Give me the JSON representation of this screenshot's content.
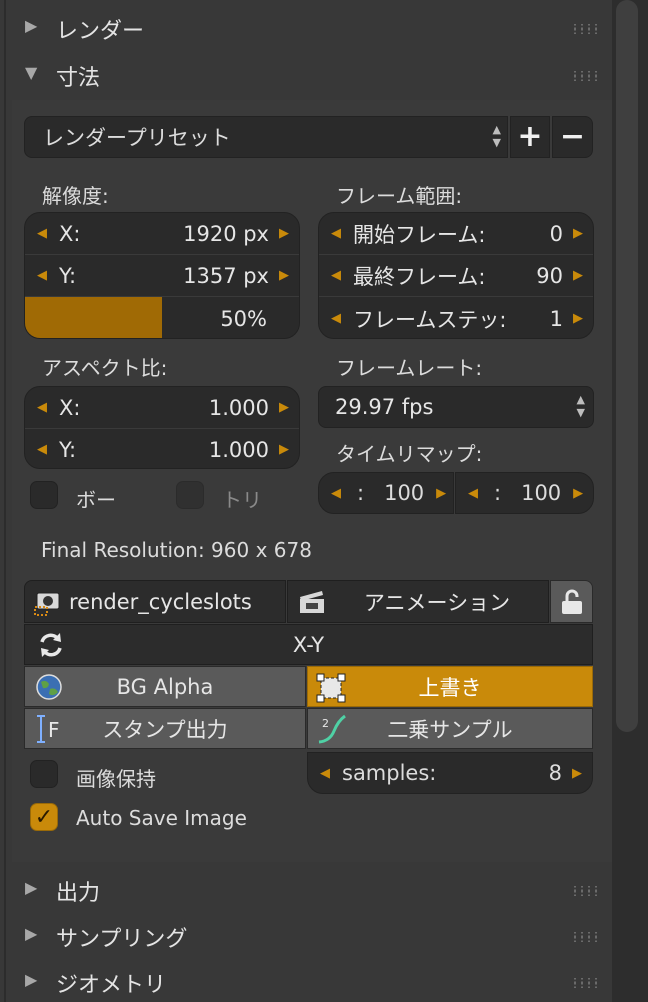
{
  "panels": {
    "render": "レンダー",
    "dimensions": "寸法",
    "output": "出力",
    "sampling": "サンプリング",
    "geometry": "ジオメトリ"
  },
  "presets": {
    "label": "レンダープリセット",
    "add": "+",
    "remove": "−"
  },
  "resolution": {
    "title": "解像度:",
    "x_label": "X:",
    "x_value": "1920 px",
    "y_label": "Y:",
    "y_value": "1357 px",
    "percent": 50,
    "percent_text": "50%"
  },
  "frame_range": {
    "title": "フレーム範囲:",
    "start_label": "開始フレーム:",
    "start_value": "0",
    "end_label": "最終フレーム:",
    "end_value": "90",
    "step_label": "フレームステッ:",
    "step_value": "1"
  },
  "aspect": {
    "title": "アスペクト比:",
    "x_label": "X:",
    "x_value": "1.000",
    "y_label": "Y:",
    "y_value": "1.000"
  },
  "frame_rate": {
    "title": "フレームレート:",
    "value": "29.97 fps"
  },
  "time_remap": {
    "title": "タイムリマップ:",
    "old_label": ":",
    "old_value": "100",
    "new_label": ":",
    "new_value": "100"
  },
  "options": {
    "border": "ボー",
    "crop": "トリ"
  },
  "final_resolution": "Final Resolution: 960 x 678",
  "addon": {
    "render_slots": "render_cycleslots",
    "animation": "アニメーション",
    "xy": "X-Y",
    "bg_alpha": "BG Alpha",
    "overwrite": "上書き",
    "stamp": "スタンプ出力",
    "squared_samples": "二乗サンプル",
    "keep_image": "画像保持",
    "samples_label": "samples:",
    "samples_value": "8",
    "auto_save": "Auto Save Image",
    "auto_save_checked": true,
    "accent_color": "#c98a0a"
  }
}
